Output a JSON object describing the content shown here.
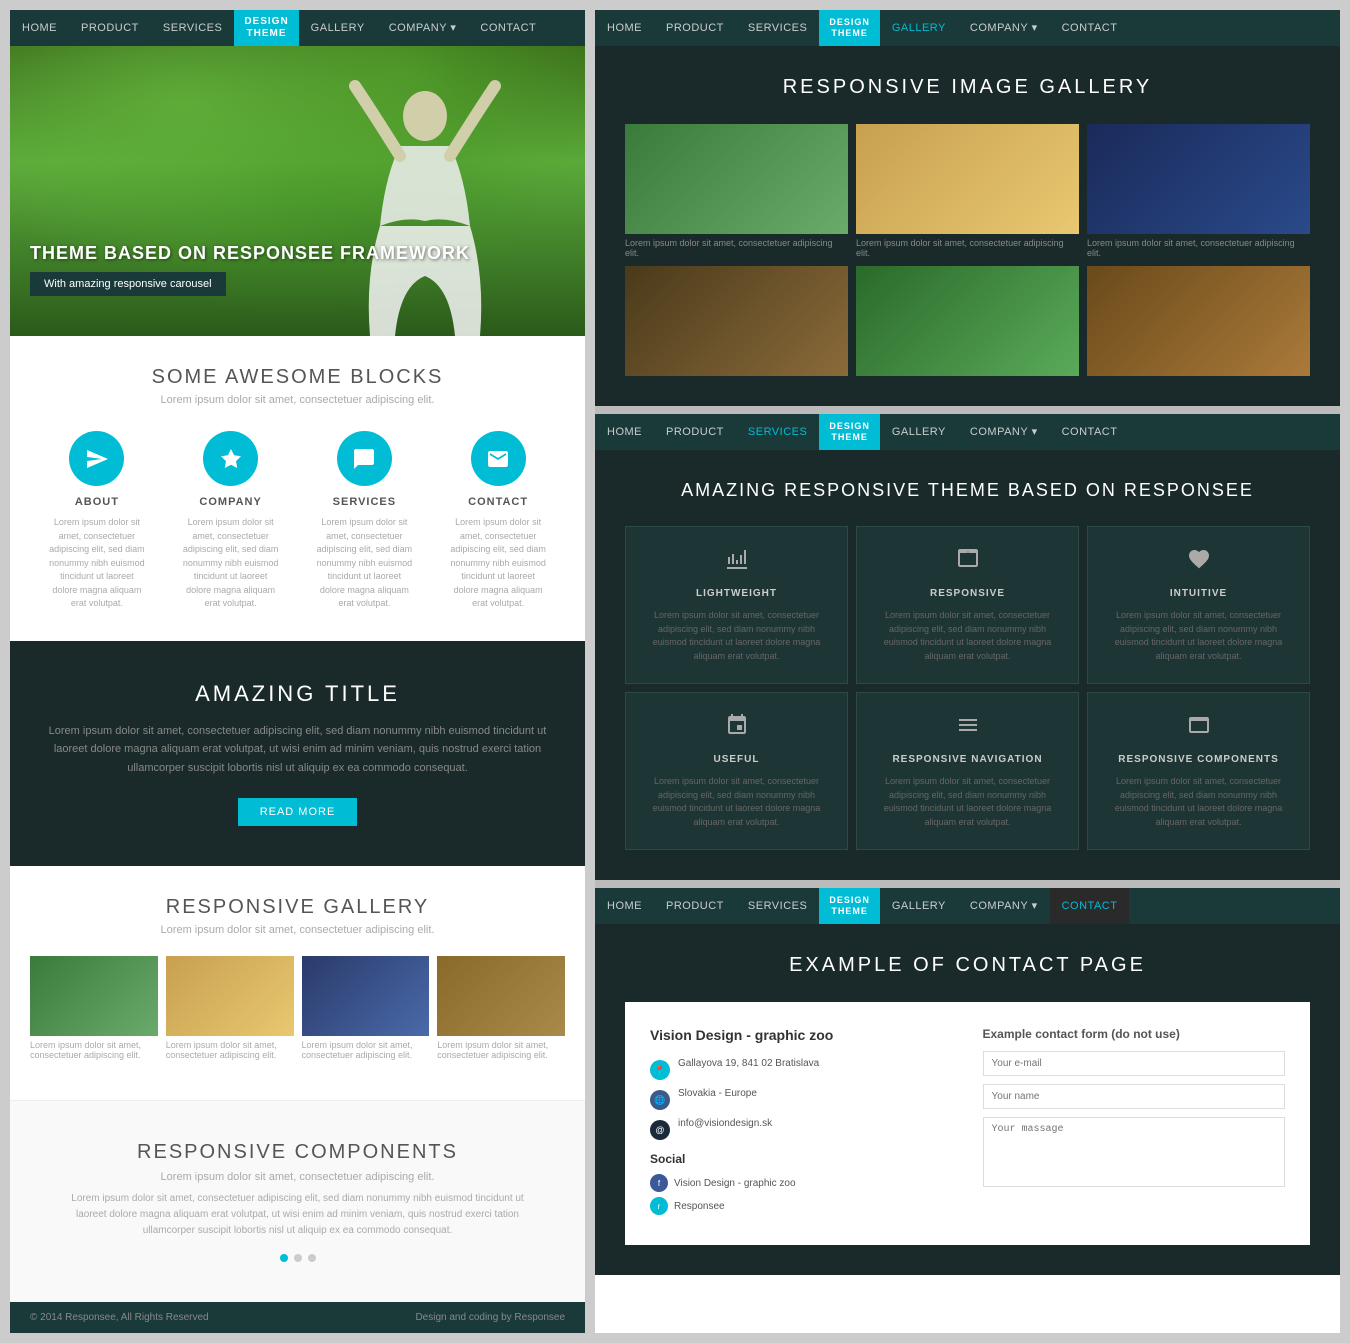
{
  "leftCol": {
    "nav": {
      "items": [
        "HOME",
        "PRODUCT",
        "SERVICES",
        "GALLERY",
        "COMPANY",
        "CONTACT"
      ],
      "activeItem": "DESIGN THEME",
      "companyHasDropdown": true
    },
    "hero": {
      "title": "THEME BASED ON RESPONSEE FRAMEWORK",
      "buttonText": "With amazing responsive carousel"
    },
    "blocksSection": {
      "title": "SOME AWESOME BLOCKS",
      "subtitle": "Lorem ipsum dolor sit amet, consectetuer adipiscing elit.",
      "items": [
        {
          "label": "ABOUT",
          "desc": "Lorem ipsum dolor sit amet, consectetuer adipiscing elit, sed diam nonummy nibh euismod tincidunt ut laoreet dolore magna aliquam erat volutpat."
        },
        {
          "label": "COMPANY",
          "desc": "Lorem ipsum dolor sit amet, consectetuer adipiscing elit, sed diam nonummy nibh euismod tincidunt ut laoreet dolore magna aliquam erat volutpat."
        },
        {
          "label": "SERVICES",
          "desc": "Lorem ipsum dolor sit amet, consectetuer adipiscing elit, sed diam nonummy nibh euismod tincidunt ut laoreet dolore magna aliquam erat volutpat."
        },
        {
          "label": "CONTACT",
          "desc": "Lorem ipsum dolor sit amet, consectetuer adipiscing elit, sed diam nonummy nibh euismod tincidunt ut laoreet dolore magna aliquam erat volutpat."
        }
      ]
    },
    "darkSection": {
      "title": "AMAZING TITLE",
      "body": "Lorem ipsum dolor sit amet, consectetuer adipiscing elit, sed diam nonummy nibh euismod tincidunt ut laoreet dolore magna aliquam erat volutpat, ut wisi enim ad minim veniam, quis nostrud exerci tation ullamcorper suscipit lobortis nisl ut aliquip ex ea commodo consequat.",
      "buttonText": "READ MORE"
    },
    "gallerySection": {
      "title": "RESPONSIVE GALLERY",
      "subtitle": "Lorem ipsum dolor sit amet, consectetuer adipiscing elit.",
      "items": [
        {
          "caption": "Lorem ipsum dolor sit amet, consectetuer adipiscing elit."
        },
        {
          "caption": "Lorem ipsum dolor sit amet, consectetuer adipiscing elit."
        },
        {
          "caption": "Lorem ipsum dolor sit amet, consectetuer adipiscing elit."
        },
        {
          "caption": "Lorem ipsum dolor sit amet, consectetuer adipiscing elit."
        }
      ]
    },
    "componentsSection": {
      "title": "RESPONSIVE COMPONENTS",
      "subtitle": "Lorem ipsum dolor sit amet, consectetuer adipiscing elit.",
      "body": "Lorem ipsum dolor sit amet, consectetuer adipiscing elit, sed diam nonummy nibh euismod tincidunt ut laoreet dolore magna aliquam erat volutpat, ut wisi enim ad minim veniam, quis nostrud exerci tation ullamcorper suscipit lobortis nisl ut aliquip ex ea commodo consequat."
    },
    "footer": {
      "copyright": "© 2014 Responsee, All Rights Reserved",
      "credit": "Design and coding by Responsee"
    }
  },
  "rightCol": {
    "galleryPage": {
      "nav": {
        "items": [
          "HOME",
          "PRODUCT",
          "SERVICES",
          "GALLERY",
          "COMPANY",
          "CONTACT"
        ],
        "activeItem": "DESIGN THEME"
      },
      "title": "RESPONSIVE IMAGE GALLERY",
      "thumbCaptions": [
        "Lorem ipsum dolor sit amet, consectetuer adipiscing elit.",
        "Lorem ipsum dolor sit amet, consectetuer adipiscing elit.",
        "Lorem ipsum dolor sit amet, consectetuer adipiscing elit."
      ]
    },
    "servicesPage": {
      "nav": {
        "items": [
          "HOME",
          "PRODUCT",
          "SERVICES",
          "GALLERY",
          "COMPANY",
          "CONTACT"
        ],
        "activeItem": "DESIGN THEME"
      },
      "title": "AMAZING RESPONSIVE THEME BASED ON RESPONSEE",
      "cards": [
        {
          "label": "LIGHTWEIGHT",
          "desc": "Lorem ipsum dolor sit amet, consectetuer adipiscing elit, sed diam nonummy nibh euismod tincidunt ut laoreet dolore magna aliquam erat volutpat."
        },
        {
          "label": "RESPONSIVE",
          "desc": "Lorem ipsum dolor sit amet, consectetuer adipiscing elit, sed diam nonummy nibh euismod tincidunt ut laoreet dolore magna aliquam erat volutpat."
        },
        {
          "label": "INTUITIVE",
          "desc": "Lorem ipsum dolor sit amet, consectetuer adipiscing elit, sed diam nonummy nibh euismod tincidunt ut laoreet dolore magna aliquam erat volutpat."
        },
        {
          "label": "USEFUL",
          "desc": "Lorem ipsum dolor sit amet, consectetuer adipiscing elit, sed diam nonummy nibh euismod tincidunt ut laoreet dolore magna aliquam erat volutpat."
        },
        {
          "label": "RESPONSIVE NAVIGATION",
          "desc": "Lorem ipsum dolor sit amet, consectetuer adipiscing elit, sed diam nonummy nibh euismod tincidunt ut laoreet dolore magna aliquam erat volutpat."
        },
        {
          "label": "RESPONSIVE COMPONENTS",
          "desc": "Lorem ipsum dolor sit amet, consectetuer adipiscing elit, sed diam nonummy nibh euismod tincidunt ut laoreet dolore magna aliquam erat volutpat."
        }
      ]
    },
    "contactPage": {
      "nav": {
        "items": [
          "HOME",
          "PRODUCT",
          "SERVICES",
          "GALLERY",
          "COMPANY",
          "CONTACT"
        ],
        "activeItem": "DESIGN THEME",
        "contactActive": true
      },
      "title": "EXAMPLE OF CONTACT PAGE",
      "leftTitle": "Vision Design - graphic zoo",
      "address": "Gallayova 19, 841 02 Bratislava",
      "country": "Slovakia - Europe",
      "email": "info@visiondesign.sk",
      "socialLabel": "Social",
      "socialItems": [
        "Vision Design - graphic zoo",
        "Responsee"
      ],
      "formTitle": "Example contact form (do not use)",
      "emailPlaceholder": "Your e-mail",
      "namePlaceholder": "Your name",
      "messagePlaceholder": "Your massage"
    }
  }
}
